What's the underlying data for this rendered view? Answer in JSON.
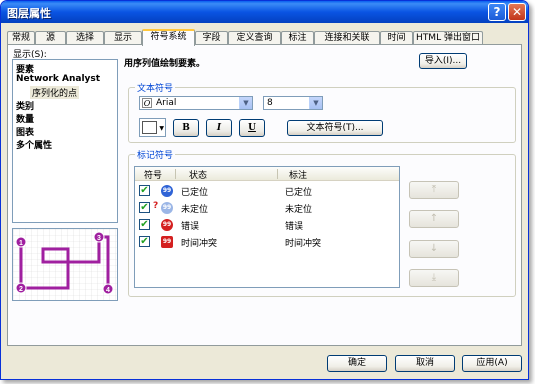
{
  "window": {
    "title": "图层属性",
    "help_glyph": "?",
    "close_glyph": "✕"
  },
  "tabs": [
    {
      "label": "常规",
      "active": false
    },
    {
      "label": "源",
      "active": false
    },
    {
      "label": "选择",
      "active": false
    },
    {
      "label": "显示",
      "active": false
    },
    {
      "label": "符号系统",
      "active": true
    },
    {
      "label": "字段",
      "active": false
    },
    {
      "label": "定义查询",
      "active": false
    },
    {
      "label": "标注",
      "active": false
    },
    {
      "label": "连接和关联",
      "active": false
    },
    {
      "label": "时间",
      "active": false
    },
    {
      "label": "HTML 弹出窗口",
      "active": false
    }
  ],
  "show_label": "显示(S):",
  "tree": {
    "items": [
      "要素",
      "Network Analyst",
      "序列化的点",
      "类别",
      "数量",
      "图表",
      "多个属性"
    ]
  },
  "preview": {
    "stops": [
      "1",
      "2",
      "3",
      "4"
    ],
    "route_color": "#a020a0"
  },
  "main": {
    "description": "用序列值绘制要素。",
    "import_label": "导入(I)..."
  },
  "text_symbol": {
    "group_title": "文本符号",
    "font_value": "Arial",
    "size_value": "8",
    "bold_label": "B",
    "italic_label": "I",
    "underline_label": "U",
    "text_symbol_button": "文本符号(T)...",
    "color_value": "#ffffff"
  },
  "marker_symbol": {
    "group_title": "标记符号",
    "columns": [
      "符号",
      "状态",
      "标注"
    ],
    "rows": [
      {
        "checked": true,
        "badge": "99",
        "badge_color": "#2f63d6",
        "extra": "",
        "state": "已定位",
        "label": "已定位"
      },
      {
        "checked": true,
        "badge": "99",
        "badge_color": "#9bb6e6",
        "extra": "?",
        "state": "未定位",
        "label": "未定位"
      },
      {
        "checked": true,
        "badge": "99",
        "badge_color": "#d42020",
        "extra": "",
        "state": "错误",
        "label": "错误"
      },
      {
        "checked": true,
        "badge": "99",
        "badge_color": "#d42020",
        "extra": "",
        "state": "时间冲突",
        "label": "时间冲突"
      }
    ],
    "move_buttons": [
      "move-top",
      "move-up",
      "move-down",
      "move-bottom"
    ]
  },
  "footer": {
    "ok": "确定",
    "cancel": "取消",
    "apply": "应用(A)"
  }
}
